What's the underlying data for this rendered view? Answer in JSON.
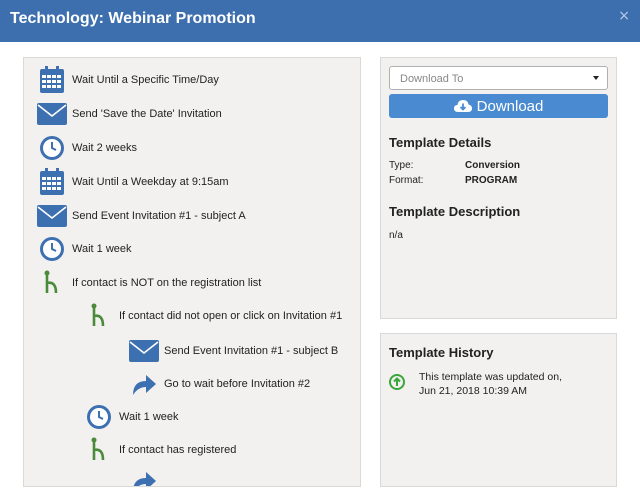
{
  "header": {
    "title": "Technology: Webinar Promotion",
    "close_glyph": "×"
  },
  "workflow": {
    "steps": [
      {
        "icon": "calendar-icon",
        "label": "Wait Until a Specific Time/Day"
      },
      {
        "icon": "envelope-icon",
        "label": "Send 'Save the Date' Invitation"
      },
      {
        "icon": "clock-icon",
        "label": "Wait 2 weeks"
      },
      {
        "icon": "calendar-icon",
        "label": "Wait Until a Weekday at 9:15am"
      },
      {
        "icon": "envelope-icon",
        "label": "Send Event Invitation #1 - subject A"
      },
      {
        "icon": "clock-icon",
        "label": "Wait 1 week"
      },
      {
        "icon": "branch-icon",
        "label": "If contact is NOT on the registration list"
      },
      {
        "icon": "branch-icon",
        "label": "If contact did not open or click on Invitation #1"
      },
      {
        "icon": "envelope-icon",
        "label": "Send Event Invitation #1 - subject B"
      },
      {
        "icon": "redirect-arrow-icon",
        "label": "Go to wait before Invitation #2"
      },
      {
        "icon": "clock-icon",
        "label": "Wait 1 week"
      },
      {
        "icon": "branch-icon",
        "label": "If contact has registered"
      },
      {
        "icon": "redirect-arrow-icon",
        "label": ""
      }
    ]
  },
  "download": {
    "select_placeholder": "Download To",
    "button_label": "Download"
  },
  "details": {
    "title": "Template Details",
    "type_key": "Type:",
    "type_value": "Conversion",
    "format_key": "Format:",
    "format_value": "PROGRAM"
  },
  "description": {
    "title": "Template Description",
    "text": "n/a"
  },
  "history": {
    "title": "Template History",
    "line1": "This template was updated on,",
    "line2": "Jun 21, 2018 10:39 AM"
  },
  "colors": {
    "header": "#3d6fae",
    "icon_blue": "#3d70b0",
    "branch_green": "#4a8a3a",
    "button": "#4a8ad0",
    "history_green": "#3aa63a"
  }
}
